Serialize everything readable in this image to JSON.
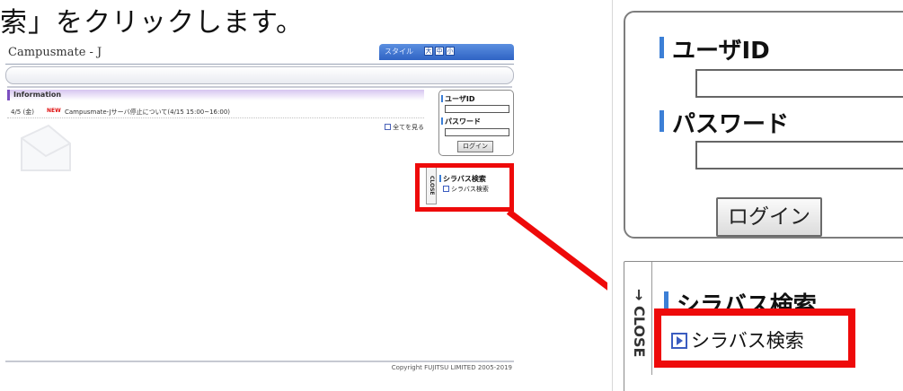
{
  "instruction": "索」をクリックします。",
  "small_screen": {
    "app_title": "Campusmate - J",
    "style_label": "スタイル",
    "font_sizes": [
      "大",
      "中",
      "小"
    ],
    "information": {
      "title": "Information",
      "news": {
        "date": "4/5 (金)",
        "badge": "NEW",
        "text": "Campusmate-Jサーバ停止について(4/15 15:00~16:00)"
      },
      "see_all": "全てを見る"
    },
    "login": {
      "user_id_label": "ユーザID",
      "user_id_value": "",
      "password_label": "パスワード",
      "password_value": "",
      "login_button": "ログイン"
    },
    "syllabus": {
      "close_tab": "CLOSE",
      "heading": "シラバス検索",
      "link": "シラバス検索"
    },
    "copyright": "Copyright FUJITSU LIMITED 2005-2019"
  },
  "zoomed": {
    "login": {
      "user_id_label": "ユーザID",
      "user_id_value": "",
      "password_label": "パスワード",
      "password_value": "",
      "login_button": "ログイン"
    },
    "syllabus": {
      "close_tab": "→ CLOSE",
      "heading": "シラバス検索",
      "link": "シラバス検索"
    }
  },
  "colors": {
    "highlight": "#ee0a0a",
    "accent_blue": "#3c7fd6",
    "info_purple": "#7c4fc0"
  }
}
